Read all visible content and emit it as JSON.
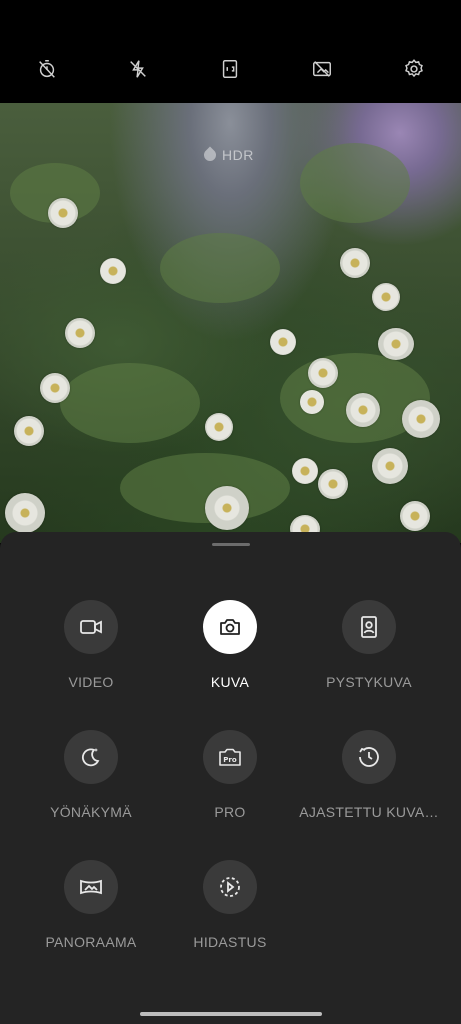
{
  "topbar": {
    "icons": [
      "timer-off-icon",
      "flash-off-icon",
      "aspect-ratio-icon",
      "filter-off-icon",
      "settings-icon"
    ]
  },
  "viewfinder": {
    "hdr_label": "HDR"
  },
  "modes": [
    {
      "label": "VIDEO",
      "icon": "video-icon",
      "selected": false
    },
    {
      "label": "KUVA",
      "icon": "camera-icon",
      "selected": true
    },
    {
      "label": "PYSTYKUVA",
      "icon": "portrait-icon",
      "selected": false
    },
    {
      "label": "YÖNÄKYMÄ",
      "icon": "night-icon",
      "selected": false
    },
    {
      "label": "PRO",
      "icon": "pro-icon",
      "selected": false
    },
    {
      "label": "AJASTETTU KUVA…",
      "icon": "timelapse-icon",
      "selected": false
    },
    {
      "label": "PANORAAMA",
      "icon": "panorama-icon",
      "selected": false
    },
    {
      "label": "HIDASTUS",
      "icon": "slow-motion-icon",
      "selected": false
    }
  ]
}
